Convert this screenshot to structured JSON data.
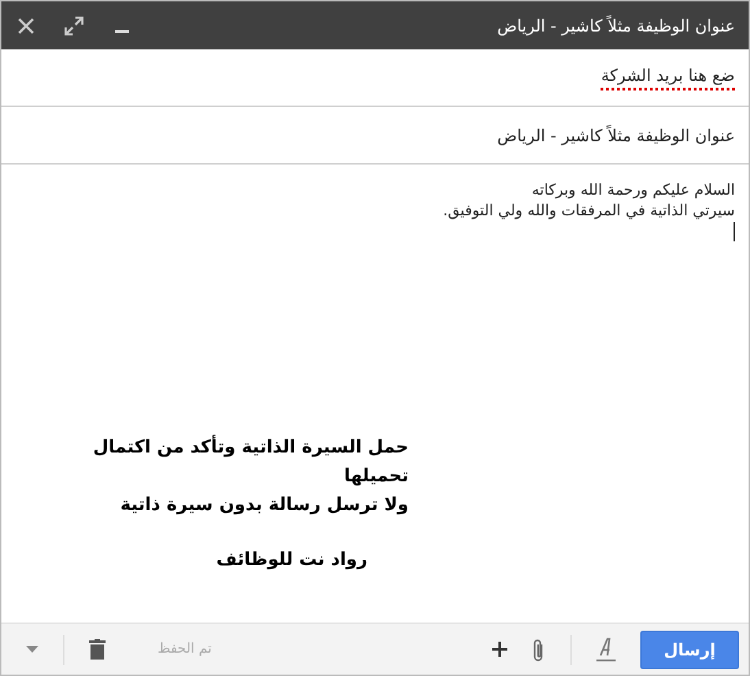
{
  "window": {
    "title": "عنوان الوظيفة مثلاً كاشير - الرياض"
  },
  "to_field": {
    "value": "ضع هنا بريد الشركة",
    "spell_error": true
  },
  "subject_field": {
    "value": "عنوان الوظيفة مثلاً كاشير - الرياض"
  },
  "body": {
    "lines": [
      "السلام عليكم ورحمة الله وبركاته",
      "سيرتي الذاتية في المرفقات والله ولي التوفيق."
    ]
  },
  "annotation": {
    "lines": [
      "حمل السيرة الذاتية وتأكد من اكتمال",
      "تحميلها",
      "ولا ترسل رسالة بدون سيرة ذاتية"
    ],
    "signature": "رواد نت للوظائف"
  },
  "toolbar": {
    "send": "إرسال",
    "saved_status": "تم الحفظ"
  }
}
